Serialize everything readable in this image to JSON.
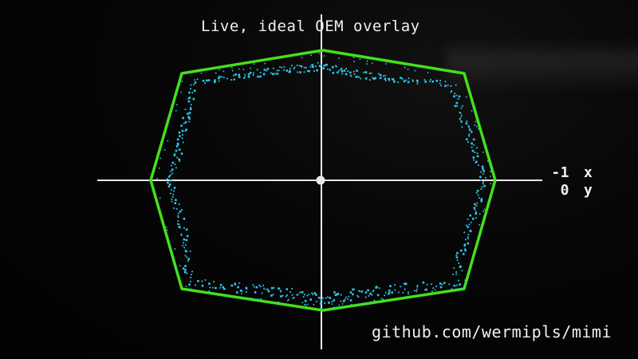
{
  "title": "Live, ideal OEM overlay",
  "readout": {
    "x_value": "-1",
    "x_label": "x",
    "y_value": "0",
    "y_label": "y"
  },
  "credit": "github.com/wermipls/mimi",
  "colors": {
    "background": "#050505",
    "axes": "#e8e8e8",
    "oem_outline": "#43e01e",
    "trace": "#2fc6ea",
    "text": "#f0f0f0"
  },
  "stick": {
    "x": -1,
    "y": 0
  }
}
